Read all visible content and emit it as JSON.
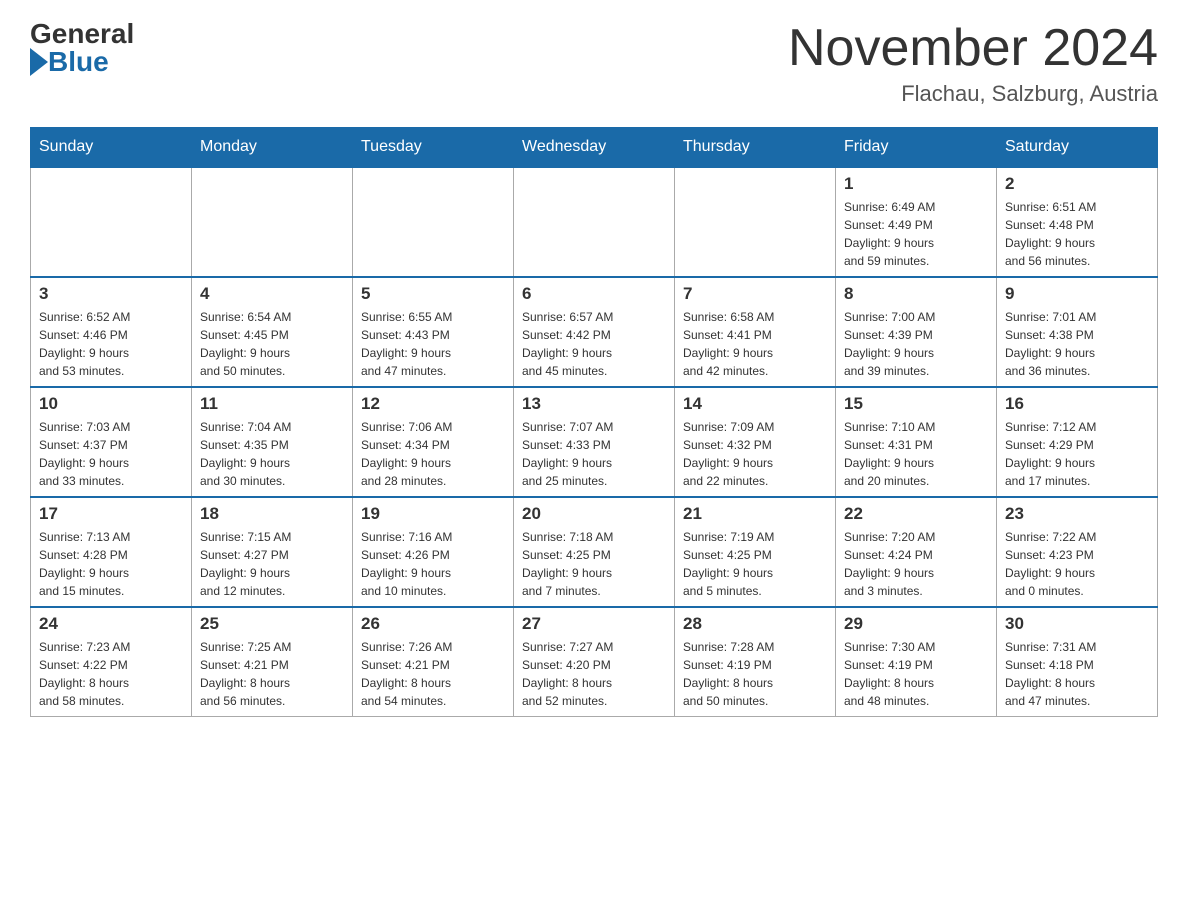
{
  "logo": {
    "general": "General",
    "blue": "Blue"
  },
  "header": {
    "month_year": "November 2024",
    "location": "Flachau, Salzburg, Austria"
  },
  "weekdays": [
    "Sunday",
    "Monday",
    "Tuesday",
    "Wednesday",
    "Thursday",
    "Friday",
    "Saturday"
  ],
  "weeks": [
    [
      {
        "day": "",
        "info": ""
      },
      {
        "day": "",
        "info": ""
      },
      {
        "day": "",
        "info": ""
      },
      {
        "day": "",
        "info": ""
      },
      {
        "day": "",
        "info": ""
      },
      {
        "day": "1",
        "info": "Sunrise: 6:49 AM\nSunset: 4:49 PM\nDaylight: 9 hours\nand 59 minutes."
      },
      {
        "day": "2",
        "info": "Sunrise: 6:51 AM\nSunset: 4:48 PM\nDaylight: 9 hours\nand 56 minutes."
      }
    ],
    [
      {
        "day": "3",
        "info": "Sunrise: 6:52 AM\nSunset: 4:46 PM\nDaylight: 9 hours\nand 53 minutes."
      },
      {
        "day": "4",
        "info": "Sunrise: 6:54 AM\nSunset: 4:45 PM\nDaylight: 9 hours\nand 50 minutes."
      },
      {
        "day": "5",
        "info": "Sunrise: 6:55 AM\nSunset: 4:43 PM\nDaylight: 9 hours\nand 47 minutes."
      },
      {
        "day": "6",
        "info": "Sunrise: 6:57 AM\nSunset: 4:42 PM\nDaylight: 9 hours\nand 45 minutes."
      },
      {
        "day": "7",
        "info": "Sunrise: 6:58 AM\nSunset: 4:41 PM\nDaylight: 9 hours\nand 42 minutes."
      },
      {
        "day": "8",
        "info": "Sunrise: 7:00 AM\nSunset: 4:39 PM\nDaylight: 9 hours\nand 39 minutes."
      },
      {
        "day": "9",
        "info": "Sunrise: 7:01 AM\nSunset: 4:38 PM\nDaylight: 9 hours\nand 36 minutes."
      }
    ],
    [
      {
        "day": "10",
        "info": "Sunrise: 7:03 AM\nSunset: 4:37 PM\nDaylight: 9 hours\nand 33 minutes."
      },
      {
        "day": "11",
        "info": "Sunrise: 7:04 AM\nSunset: 4:35 PM\nDaylight: 9 hours\nand 30 minutes."
      },
      {
        "day": "12",
        "info": "Sunrise: 7:06 AM\nSunset: 4:34 PM\nDaylight: 9 hours\nand 28 minutes."
      },
      {
        "day": "13",
        "info": "Sunrise: 7:07 AM\nSunset: 4:33 PM\nDaylight: 9 hours\nand 25 minutes."
      },
      {
        "day": "14",
        "info": "Sunrise: 7:09 AM\nSunset: 4:32 PM\nDaylight: 9 hours\nand 22 minutes."
      },
      {
        "day": "15",
        "info": "Sunrise: 7:10 AM\nSunset: 4:31 PM\nDaylight: 9 hours\nand 20 minutes."
      },
      {
        "day": "16",
        "info": "Sunrise: 7:12 AM\nSunset: 4:29 PM\nDaylight: 9 hours\nand 17 minutes."
      }
    ],
    [
      {
        "day": "17",
        "info": "Sunrise: 7:13 AM\nSunset: 4:28 PM\nDaylight: 9 hours\nand 15 minutes."
      },
      {
        "day": "18",
        "info": "Sunrise: 7:15 AM\nSunset: 4:27 PM\nDaylight: 9 hours\nand 12 minutes."
      },
      {
        "day": "19",
        "info": "Sunrise: 7:16 AM\nSunset: 4:26 PM\nDaylight: 9 hours\nand 10 minutes."
      },
      {
        "day": "20",
        "info": "Sunrise: 7:18 AM\nSunset: 4:25 PM\nDaylight: 9 hours\nand 7 minutes."
      },
      {
        "day": "21",
        "info": "Sunrise: 7:19 AM\nSunset: 4:25 PM\nDaylight: 9 hours\nand 5 minutes."
      },
      {
        "day": "22",
        "info": "Sunrise: 7:20 AM\nSunset: 4:24 PM\nDaylight: 9 hours\nand 3 minutes."
      },
      {
        "day": "23",
        "info": "Sunrise: 7:22 AM\nSunset: 4:23 PM\nDaylight: 9 hours\nand 0 minutes."
      }
    ],
    [
      {
        "day": "24",
        "info": "Sunrise: 7:23 AM\nSunset: 4:22 PM\nDaylight: 8 hours\nand 58 minutes."
      },
      {
        "day": "25",
        "info": "Sunrise: 7:25 AM\nSunset: 4:21 PM\nDaylight: 8 hours\nand 56 minutes."
      },
      {
        "day": "26",
        "info": "Sunrise: 7:26 AM\nSunset: 4:21 PM\nDaylight: 8 hours\nand 54 minutes."
      },
      {
        "day": "27",
        "info": "Sunrise: 7:27 AM\nSunset: 4:20 PM\nDaylight: 8 hours\nand 52 minutes."
      },
      {
        "day": "28",
        "info": "Sunrise: 7:28 AM\nSunset: 4:19 PM\nDaylight: 8 hours\nand 50 minutes."
      },
      {
        "day": "29",
        "info": "Sunrise: 7:30 AM\nSunset: 4:19 PM\nDaylight: 8 hours\nand 48 minutes."
      },
      {
        "day": "30",
        "info": "Sunrise: 7:31 AM\nSunset: 4:18 PM\nDaylight: 8 hours\nand 47 minutes."
      }
    ]
  ]
}
